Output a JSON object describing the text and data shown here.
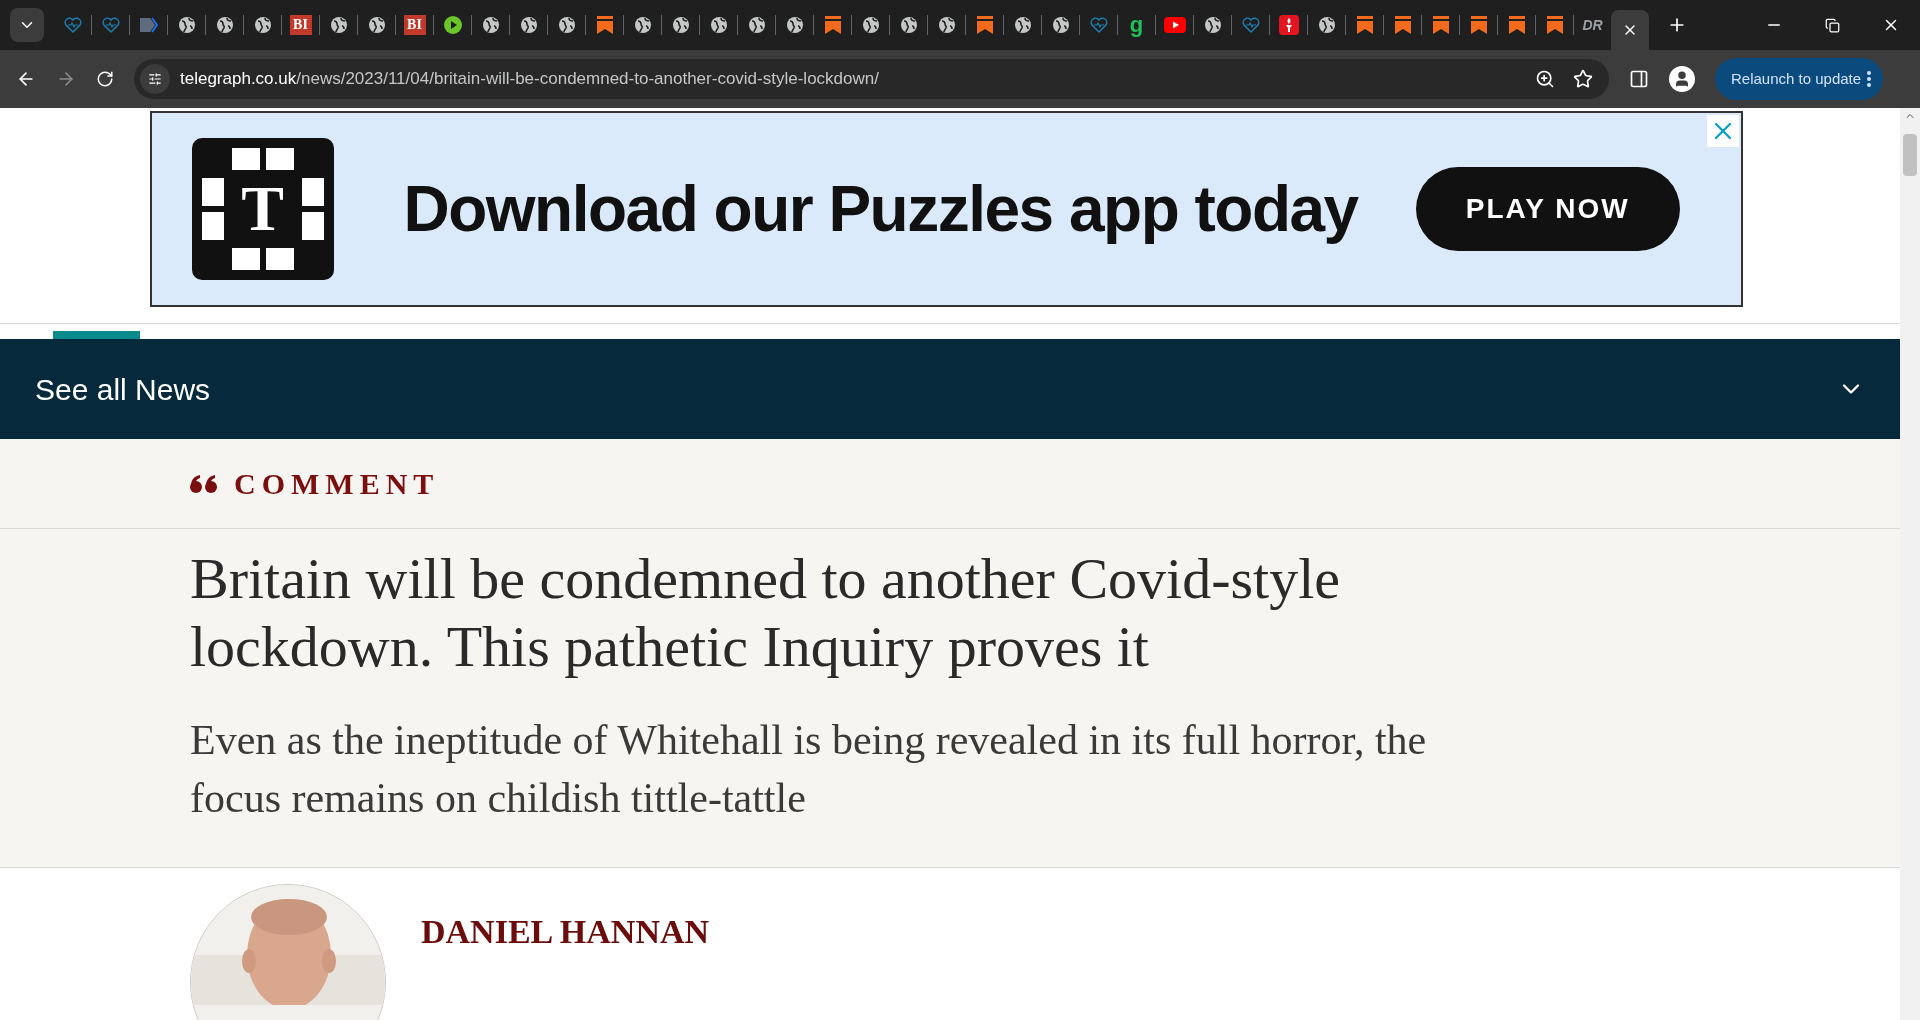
{
  "browser": {
    "tabs": [
      {
        "kind": "heart",
        "selected": false
      },
      {
        "kind": "heart",
        "selected": false
      },
      {
        "kind": "arrow",
        "selected": false
      },
      {
        "kind": "globe",
        "selected": false
      },
      {
        "kind": "globe",
        "selected": false
      },
      {
        "kind": "globe",
        "selected": false
      },
      {
        "kind": "bi",
        "glyph": "BI",
        "selected": false
      },
      {
        "kind": "globe",
        "selected": false
      },
      {
        "kind": "globe",
        "selected": false
      },
      {
        "kind": "bi",
        "glyph": "BI",
        "selected": false
      },
      {
        "kind": "play",
        "selected": false
      },
      {
        "kind": "globe",
        "selected": false
      },
      {
        "kind": "globe",
        "selected": false
      },
      {
        "kind": "globe",
        "selected": false
      },
      {
        "kind": "bookmark",
        "selected": false
      },
      {
        "kind": "globe",
        "selected": false
      },
      {
        "kind": "globe",
        "selected": false
      },
      {
        "kind": "globe",
        "selected": false
      },
      {
        "kind": "globe",
        "selected": false
      },
      {
        "kind": "globe",
        "selected": false
      },
      {
        "kind": "bookmark",
        "selected": false
      },
      {
        "kind": "globe",
        "selected": false
      },
      {
        "kind": "globe",
        "selected": false
      },
      {
        "kind": "globe",
        "selected": false
      },
      {
        "kind": "bookmark",
        "selected": false
      },
      {
        "kind": "globe",
        "selected": false
      },
      {
        "kind": "globe",
        "selected": false
      },
      {
        "kind": "heart",
        "selected": false
      },
      {
        "kind": "letter",
        "glyph": "g",
        "selected": false
      },
      {
        "kind": "youtube",
        "selected": false
      },
      {
        "kind": "globe",
        "selected": false
      },
      {
        "kind": "heart",
        "selected": false
      },
      {
        "kind": "torch",
        "selected": false
      },
      {
        "kind": "globe",
        "selected": false
      },
      {
        "kind": "bookmark",
        "selected": false
      },
      {
        "kind": "bookmark",
        "selected": false
      },
      {
        "kind": "bookmark",
        "selected": false
      },
      {
        "kind": "bookmark",
        "selected": false
      },
      {
        "kind": "bookmark",
        "selected": false
      },
      {
        "kind": "bookmark",
        "selected": false
      },
      {
        "kind": "dr",
        "glyph": "DR",
        "selected": false
      },
      {
        "kind": "blank",
        "selected": true
      }
    ],
    "url_host": "telegraph.co.uk",
    "url_path": "/news/2023/11/04/britain-will-be-condemned-to-another-covid-style-lockdown/",
    "relaunch": "Relaunch to update"
  },
  "ad": {
    "logo_glyph": "T",
    "headline": "Download our Puzzles app today",
    "button": "PLAY NOW"
  },
  "nav": {
    "label": "See all News",
    "expanded": false
  },
  "article": {
    "section": "COMMENT",
    "headline": "Britain will be condemned to another Covid-style lockdown. This pathetic Inquiry proves it",
    "standfirst": "Even as the ineptitude of Whitehall is being revealed in its full horror, the focus remains on childish tittle-tattle",
    "author": "DANIEL HANNAN"
  }
}
